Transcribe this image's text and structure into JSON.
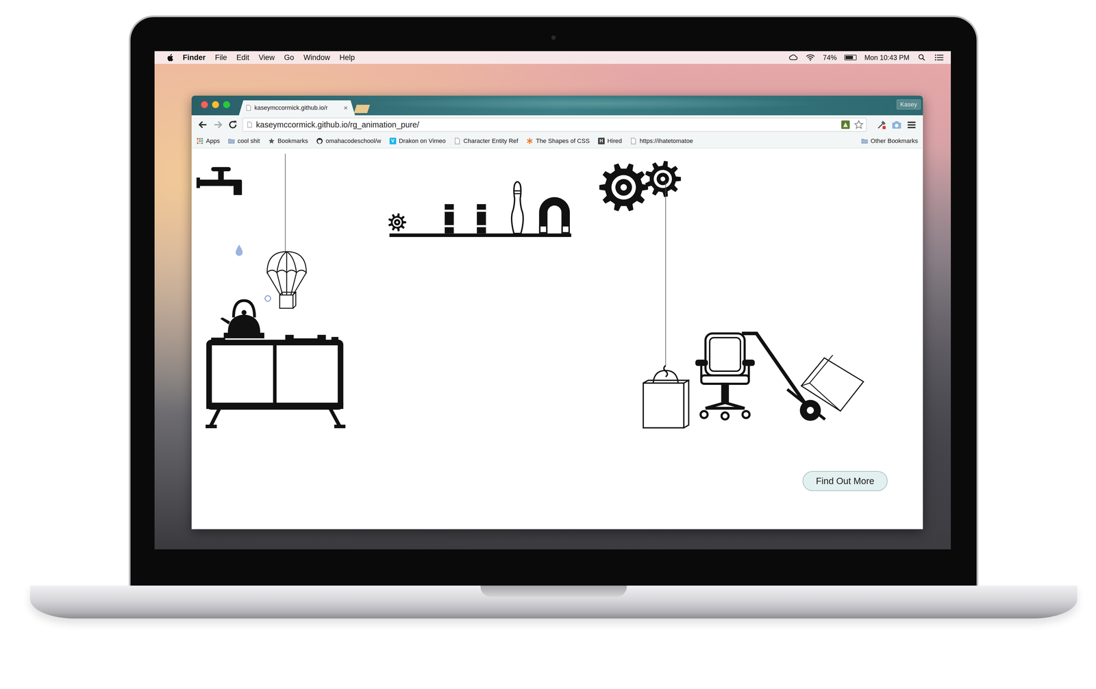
{
  "menubar": {
    "app": "Finder",
    "menus": [
      "File",
      "Edit",
      "View",
      "Go",
      "Window",
      "Help"
    ],
    "battery": {
      "reading": "74%",
      "level": 0.74
    },
    "clock": "Mon 10:43 PM"
  },
  "browser": {
    "tabs": [
      {
        "title": "kaseymccormick.github.io/r",
        "close": "×",
        "selected": true
      }
    ],
    "profile": "Kasey",
    "url": "kaseymccormick.github.io/rg_animation_pure/",
    "bookmarks": [
      {
        "label": "Apps",
        "kind": "apps"
      },
      {
        "label": "cool shit",
        "kind": "folder"
      },
      {
        "label": "Bookmarks",
        "kind": "star"
      },
      {
        "label": "omahacodeschool/w",
        "kind": "github"
      },
      {
        "label": "Drakon on Vimeo",
        "kind": "vimeo",
        "badge": "V"
      },
      {
        "label": "Character Entity Ref",
        "kind": "page"
      },
      {
        "label": "The Shapes of CSS",
        "kind": "asterisk"
      },
      {
        "label": "Hired",
        "kind": "hired",
        "badge": "H"
      },
      {
        "label": "https://ihatetomatoe",
        "kind": "page"
      }
    ],
    "other_bookmarks": {
      "label": "Other Bookmarks",
      "kind": "folder"
    }
  },
  "page": {
    "button": "Find Out More"
  }
}
